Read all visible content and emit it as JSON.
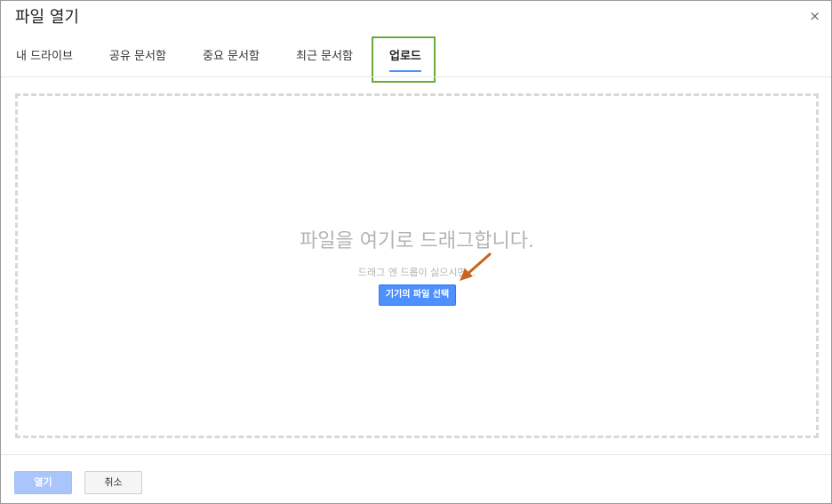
{
  "dialog": {
    "title": "파일 열기",
    "close_symbol": "×"
  },
  "tabs": [
    {
      "label": "내 드라이브",
      "active": false
    },
    {
      "label": "공유 문서함",
      "active": false
    },
    {
      "label": "중요 문서함",
      "active": false
    },
    {
      "label": "최근 문서함",
      "active": false
    },
    {
      "label": "업로드",
      "active": true
    }
  ],
  "dropzone": {
    "main_text": "파일을 여기로 드래그합니다.",
    "sub_text": "드래그 앤 드롭이 싫으시면...",
    "select_button_label": "기기의 파일 선택"
  },
  "footer": {
    "open_label": "열기",
    "cancel_label": "취소"
  },
  "icons": {
    "close": "close-icon",
    "annotation_arrow": "arrow-icon"
  },
  "colors": {
    "accent": "#4d90fe",
    "highlight": "#6aaa38",
    "arrow": "#c8641e"
  }
}
